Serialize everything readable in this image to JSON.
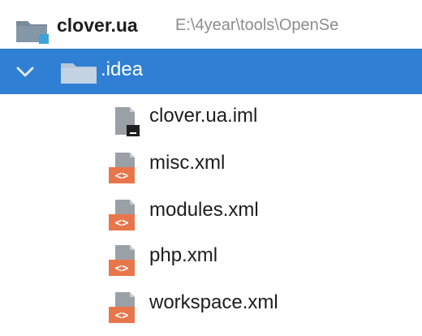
{
  "tree": {
    "root": {
      "name": "clover.ua",
      "path": "E:\\4year\\tools\\OpenSe",
      "icon": "module-folder-icon"
    },
    "selected_folder": {
      "name": ".idea",
      "expanded": true,
      "icon": "folder-icon",
      "selection_color": "#2f7fd4"
    },
    "files": [
      {
        "name": "clover.ua.iml",
        "icon": "iml-file-icon"
      },
      {
        "name": "misc.xml",
        "icon": "xml-file-icon"
      },
      {
        "name": "modules.xml",
        "icon": "xml-file-icon"
      },
      {
        "name": "php.xml",
        "icon": "xml-file-icon"
      },
      {
        "name": "workspace.xml",
        "icon": "xml-file-icon"
      }
    ]
  }
}
